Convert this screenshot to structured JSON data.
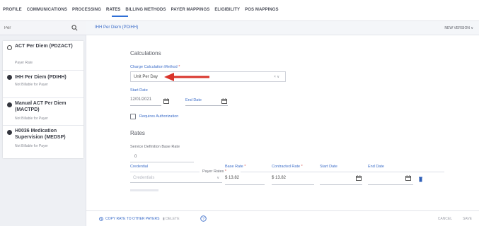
{
  "tabs": [
    {
      "label": "PROFILE"
    },
    {
      "label": "COMMUNICATIONS"
    },
    {
      "label": "PROCESSING"
    },
    {
      "label": "RATES"
    },
    {
      "label": "BILLING METHODS"
    },
    {
      "label": "PAYER MAPPINGS"
    },
    {
      "label": "ELIGIBILITY"
    },
    {
      "label": "POS MAPPINGS"
    }
  ],
  "active_tab": "RATES",
  "search": {
    "value": "Per"
  },
  "rate_cards": [
    {
      "title": "ACT Per Diem (PDZACT)",
      "subtitle": "Payer Rate",
      "icon": "radio-outline-icon"
    },
    {
      "title": "IHH Per Diem (PDIHH)",
      "subtitle": "Not Billable for Payer",
      "icon": "radio-filled-icon"
    },
    {
      "title": "Manual ACT Per Diem (MACTPD)",
      "subtitle": "Not Billable for Payer",
      "icon": "radio-filled-icon"
    },
    {
      "title": "H0036 Medication Supervision (MEDSP)",
      "subtitle": "Not Billable for Payer",
      "icon": "radio-filled-icon"
    }
  ],
  "header": {
    "rate_title": "IHH Per Diem (PDIHH)",
    "new_version": "NEW VERSION ∨"
  },
  "calculations": {
    "section_title": "Calculations",
    "method_label": "Charge Calculation Method",
    "method_value": "Unit Per Day",
    "start_date_label": "Start Date",
    "start_date_value": "12/01/2021",
    "end_date_label": "End Date",
    "requires_auth_label": "Requires Authorization"
  },
  "rates": {
    "section_title": "Rates",
    "base_rate_label": "Service Definition Base Rate",
    "base_rate_value": "0",
    "payer_rates_title": "Payer Rates",
    "columns": {
      "credential": "Credential",
      "base_rate": "Base Rate",
      "contracted_rate": "Contracted Rate",
      "start_date": "Start Date",
      "end_date": "End Date"
    },
    "row": {
      "credential_placeholder": "Credentials",
      "base_rate": "$ 13.82",
      "contracted_rate": "$ 13.82"
    }
  },
  "footer": {
    "copy_rate": "COPY RATE TO OTHER PAYERS",
    "delete": "DELETE",
    "cancel": "CANCEL",
    "save": "SAVE"
  },
  "colors": {
    "accent": "#2f6fd6",
    "annotation_arrow": "#d9342b"
  }
}
